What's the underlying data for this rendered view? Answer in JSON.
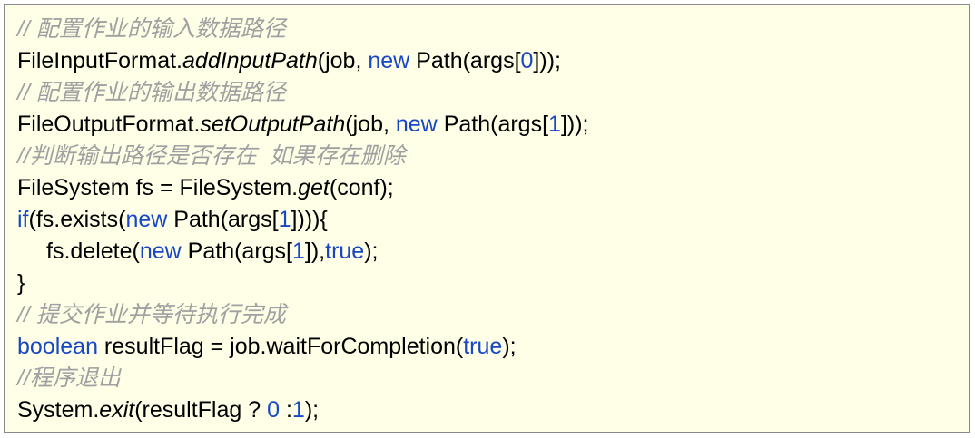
{
  "colors": {
    "background": "#ffffe7",
    "border": "#8a8a8a",
    "text": "#000000",
    "keyword": "#1747c4",
    "comment": "#a0a0a0"
  },
  "code": {
    "lines": [
      {
        "segments": [
          {
            "text": "// 配置作业的输入数据路径",
            "style": "comment"
          }
        ]
      },
      {
        "segments": [
          {
            "text": "FileInputFormat.",
            "style": "plain"
          },
          {
            "text": "addInputPath",
            "style": "italic"
          },
          {
            "text": "(job, ",
            "style": "plain"
          },
          {
            "text": "new",
            "style": "keyword"
          },
          {
            "text": " Path(args[",
            "style": "plain"
          },
          {
            "text": "0",
            "style": "number"
          },
          {
            "text": "]));",
            "style": "plain"
          }
        ]
      },
      {
        "segments": [
          {
            "text": "// 配置作业的输出数据路径",
            "style": "comment"
          }
        ]
      },
      {
        "segments": [
          {
            "text": "FileOutputFormat.",
            "style": "plain"
          },
          {
            "text": "setOutputPath",
            "style": "italic"
          },
          {
            "text": "(job, ",
            "style": "plain"
          },
          {
            "text": "new",
            "style": "keyword"
          },
          {
            "text": " Path(args[",
            "style": "plain"
          },
          {
            "text": "1",
            "style": "number"
          },
          {
            "text": "]));",
            "style": "plain"
          }
        ]
      },
      {
        "segments": [
          {
            "text": "//判断输出路径是否存在  如果存在删除",
            "style": "comment"
          }
        ]
      },
      {
        "segments": [
          {
            "text": "FileSystem fs = FileSystem.",
            "style": "plain"
          },
          {
            "text": "get",
            "style": "italic"
          },
          {
            "text": "(conf);",
            "style": "plain"
          }
        ]
      },
      {
        "segments": [
          {
            "text": "if",
            "style": "keyword"
          },
          {
            "text": "(fs.exists(",
            "style": "plain"
          },
          {
            "text": "new",
            "style": "keyword"
          },
          {
            "text": " Path(args[",
            "style": "plain"
          },
          {
            "text": "1",
            "style": "number"
          },
          {
            "text": "]))){",
            "style": "plain"
          }
        ]
      },
      {
        "indent": true,
        "segments": [
          {
            "text": "fs.delete(",
            "style": "plain"
          },
          {
            "text": "new",
            "style": "keyword"
          },
          {
            "text": " Path(args[",
            "style": "plain"
          },
          {
            "text": "1",
            "style": "number"
          },
          {
            "text": "]),",
            "style": "plain"
          },
          {
            "text": "true",
            "style": "keyword"
          },
          {
            "text": ");",
            "style": "plain"
          }
        ]
      },
      {
        "segments": [
          {
            "text": "}",
            "style": "plain"
          }
        ]
      },
      {
        "segments": [
          {
            "text": "// 提交作业并等待执行完成",
            "style": "comment"
          }
        ]
      },
      {
        "segments": [
          {
            "text": "boolean",
            "style": "keyword"
          },
          {
            "text": " resultFlag = job.waitForCompletion(",
            "style": "plain"
          },
          {
            "text": "true",
            "style": "keyword"
          },
          {
            "text": ");",
            "style": "plain"
          }
        ]
      },
      {
        "segments": [
          {
            "text": "//程序退出",
            "style": "comment"
          }
        ]
      },
      {
        "segments": [
          {
            "text": "System.",
            "style": "plain"
          },
          {
            "text": "exit",
            "style": "italic"
          },
          {
            "text": "(resultFlag ? ",
            "style": "plain"
          },
          {
            "text": "0",
            "style": "number"
          },
          {
            "text": " :",
            "style": "plain"
          },
          {
            "text": "1",
            "style": "number"
          },
          {
            "text": ");",
            "style": "plain"
          }
        ]
      }
    ]
  }
}
